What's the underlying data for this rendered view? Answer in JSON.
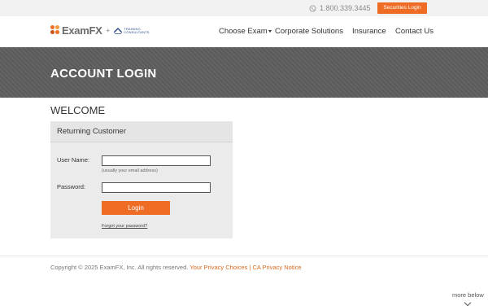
{
  "topbar": {
    "phone": "1.800.339.3445",
    "securities_login": "Securities Login"
  },
  "nav": {
    "logo_text": "ExamFX",
    "plus": "+",
    "partner_line1": "TRAINING",
    "partner_line2": "CONSULTANTS",
    "items": [
      {
        "label": "Choose Exam"
      },
      {
        "label": "Corporate Solutions"
      },
      {
        "label": "Insurance"
      },
      {
        "label": "Contact Us"
      }
    ]
  },
  "banner": {
    "title": "ACCOUNT LOGIN"
  },
  "welcome": "WELCOME",
  "login_panel": {
    "header": "Returning Customer",
    "username_label": "User Name:",
    "username_value": "",
    "username_hint": "(usually your email address)",
    "password_label": "Password:",
    "password_value": "",
    "login_button": "Login",
    "forgot_link": "Forgot your password?"
  },
  "footer": {
    "copyright": "Copyright © 2025 ExamFX, Inc. All rights reserved.",
    "privacy_choices": "Your Privacy Choices",
    "separator": "|",
    "ca_notice": "CA Privacy Notice"
  },
  "more_below": "more below",
  "colors": {
    "accent": "#ef6c25",
    "banner": "#5e5e5e",
    "link": "#d8691f"
  },
  "icons": [
    "phone-icon",
    "examfx-logo-icon",
    "partner-logo-icon",
    "chevron-down-icon"
  ]
}
